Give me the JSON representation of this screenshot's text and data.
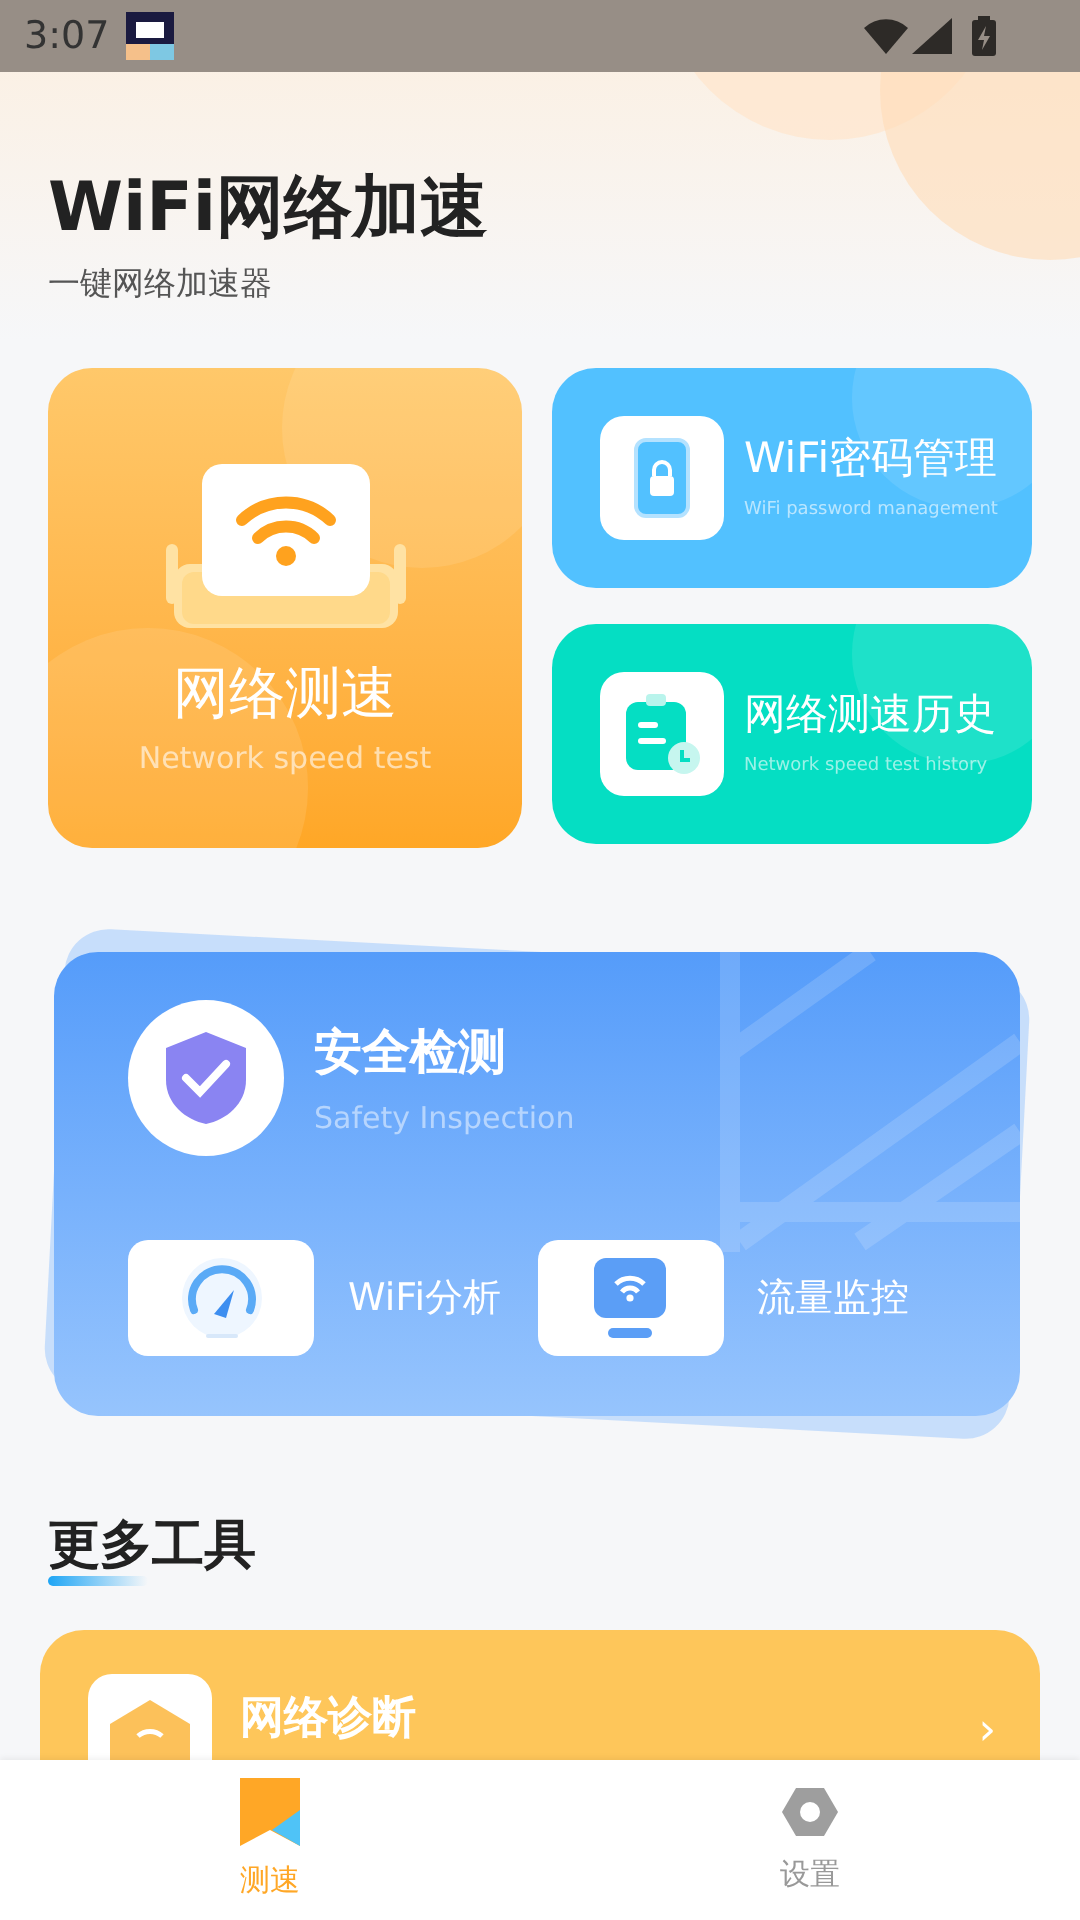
{
  "status_bar": {
    "time": "3:07"
  },
  "header": {
    "title": "WiFi网络加速",
    "subtitle": "一键网络加速器"
  },
  "feature_cards": [
    {
      "kind": "speed",
      "title": "网络测速",
      "subtitle": "Network speed test"
    },
    {
      "kind": "password",
      "title": "WiFi密码管理",
      "subtitle": "WiFi password management"
    },
    {
      "kind": "history",
      "title": "网络测速历史",
      "subtitle": "Network speed test history"
    }
  ],
  "safety": {
    "title": "安全检测",
    "subtitle": "Safety Inspection",
    "tools": [
      {
        "kind": "gauge",
        "label": "WiFi分析"
      },
      {
        "kind": "monitor",
        "label": "流量监控"
      }
    ]
  },
  "more_tools": {
    "title": "更多工具",
    "items": [
      {
        "label": "网络诊断",
        "arrow": "›"
      }
    ]
  },
  "tab_bar": [
    {
      "kind": "speed",
      "label": "测速",
      "selected": true
    },
    {
      "kind": "settings",
      "label": "设置",
      "selected": false
    }
  ]
}
